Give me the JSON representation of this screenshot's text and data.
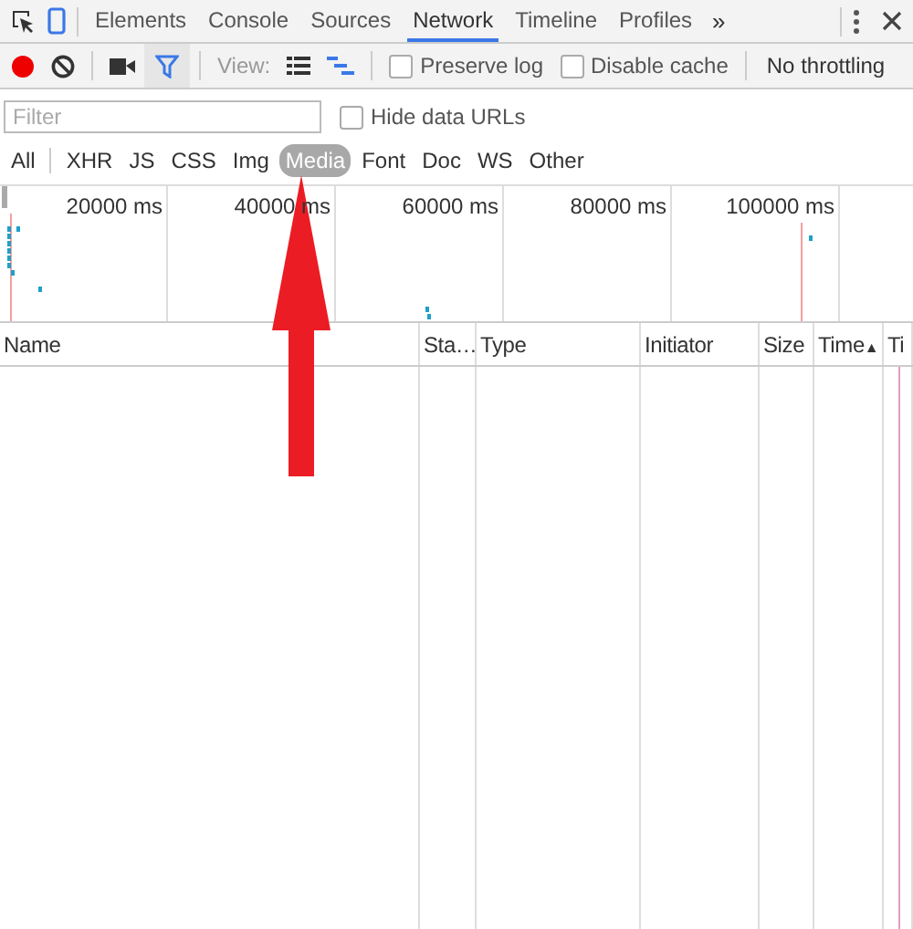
{
  "main_tabs": [
    {
      "label": "Elements",
      "selected": false
    },
    {
      "label": "Console",
      "selected": false
    },
    {
      "label": "Sources",
      "selected": false
    },
    {
      "label": "Network",
      "selected": true
    },
    {
      "label": "Timeline",
      "selected": false
    },
    {
      "label": "Profiles",
      "selected": false
    }
  ],
  "overflow": "»",
  "toolbar": {
    "recording": true,
    "filter_active": true,
    "view_label": "View:",
    "large_rows": false,
    "show_overview": true,
    "options": [
      {
        "label": "Preserve log",
        "checked": false
      },
      {
        "label": "Disable cache",
        "checked": false
      }
    ],
    "throttling": "No throttling"
  },
  "filter": {
    "placeholder": "Filter"
  },
  "hide_data_urls": {
    "label": "Hide data URLs",
    "checked": false
  },
  "type_filters": [
    {
      "label": "All",
      "selected": false
    },
    {
      "label": "XHR",
      "selected": false
    },
    {
      "label": "JS",
      "selected": false
    },
    {
      "label": "CSS",
      "selected": false
    },
    {
      "label": "Img",
      "selected": false
    },
    {
      "label": "Media",
      "selected": true
    },
    {
      "label": "Font",
      "selected": false
    },
    {
      "label": "Doc",
      "selected": false
    },
    {
      "label": "WS",
      "selected": false
    },
    {
      "label": "Other",
      "selected": false
    }
  ],
  "overview": {
    "ticks": [
      "20000 ms",
      "40000 ms",
      "60000 ms",
      "80000 ms",
      "100000 ms"
    ]
  },
  "columns": [
    {
      "label": "Name"
    },
    {
      "label": "Sta…"
    },
    {
      "label": "Type"
    },
    {
      "label": "Initiator"
    },
    {
      "label": "Size"
    },
    {
      "label": "Time",
      "sort": "▲"
    },
    {
      "label": "Ti"
    }
  ]
}
